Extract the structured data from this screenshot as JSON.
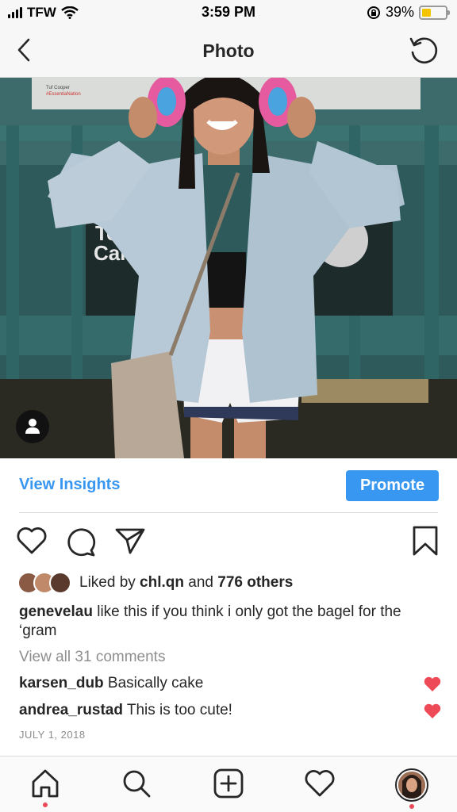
{
  "status_bar": {
    "carrier": "TFW",
    "time": "3:59 PM",
    "battery": "39%",
    "battery_level": 0.39
  },
  "nav": {
    "title": "Photo"
  },
  "photo_sign": {
    "line1": "To F",
    "line2": "Cana",
    "small1": "Tuf Cooper",
    "small2": "#EssentiaNation"
  },
  "insights": {
    "view_insights": "View Insights",
    "promote": "Promote"
  },
  "likes": {
    "prefix": "Liked by ",
    "user": "chl.qn",
    "middle": " and ",
    "others": "776 others"
  },
  "caption": {
    "username": "genevelau",
    "text": " like this if you think i only got the bagel for the ‘gram"
  },
  "view_all_comments": "View all 31 comments",
  "comments": [
    {
      "username": "karsen_dub",
      "text": " Basically cake"
    },
    {
      "username": "andrea_rustad",
      "text": " This is too cute!"
    }
  ],
  "date": "JULY 1, 2018",
  "colors": {
    "accent": "#3897f0",
    "like_red": "#ed4956",
    "text": "#262626",
    "muted": "#8e8e8e"
  }
}
